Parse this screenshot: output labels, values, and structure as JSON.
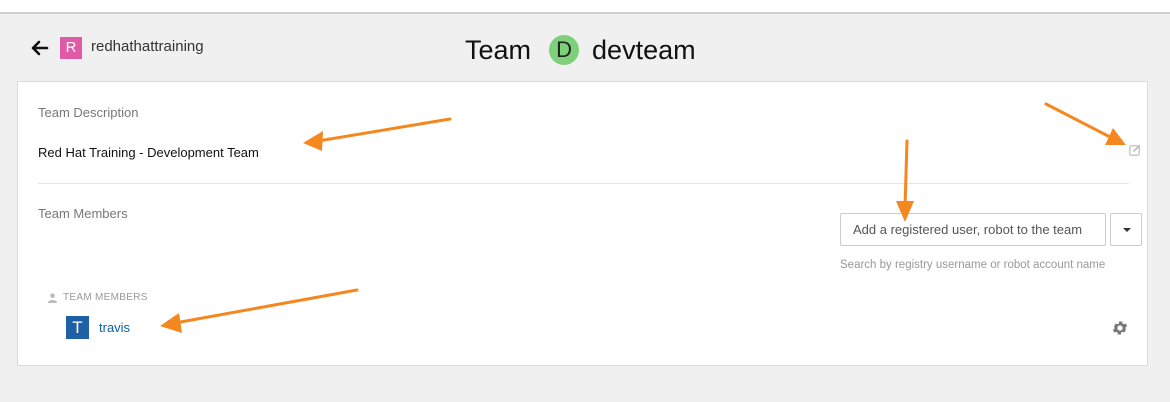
{
  "header": {
    "back_icon": "arrow-left-icon",
    "org": {
      "initial": "R",
      "name": "redhathattraining",
      "avatar_color": "#e15aa7"
    },
    "title": {
      "prefix": "Team",
      "team_initial": "D",
      "team_name": "devteam",
      "team_avatar_color": "#7ed07b"
    }
  },
  "description": {
    "label": "Team Description",
    "text": "Red Hat Training - Development Team",
    "edit_icon": "edit-icon"
  },
  "members_section": {
    "label": "Team Members",
    "add_input": {
      "placeholder": "Add a registered user, robot to the team",
      "value": ""
    },
    "dropdown_icon": "caret-down-icon",
    "help_text": "Search by registry username or robot account name",
    "list_header": "TEAM MEMBERS",
    "list_header_icon": "user-icon",
    "members": [
      {
        "initial": "T",
        "name": "travis",
        "avatar_color": "#1f5fa5",
        "options_icon": "gear-icon"
      }
    ]
  },
  "annotation_color": "#f5871f"
}
